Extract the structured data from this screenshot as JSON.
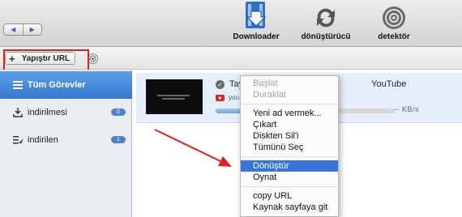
{
  "toolbar": {
    "nav_back_icon": "triangle-left",
    "nav_forward_icon": "triangle-right",
    "tools": [
      {
        "label": "Downloader",
        "icon": "downloader-icon"
      },
      {
        "label": "dönüştürücü",
        "icon": "convert-icon"
      },
      {
        "label": "detektör",
        "icon": "detector-icon"
      }
    ]
  },
  "bar2": {
    "paste_label": "Yapıştır URL",
    "paste_prefix": "+"
  },
  "sidebar": {
    "items": [
      {
        "label": "Tüm Görevler",
        "icon": "list-icon",
        "active": true
      },
      {
        "label": "indirilmesi",
        "icon": "download-tray-icon",
        "count": "0"
      },
      {
        "label": "indirilen",
        "icon": "downloaded-list-icon",
        "count": "1"
      }
    ]
  },
  "task": {
    "title_start": "Tay",
    "title_end": "YouTube",
    "source": "you",
    "speed": "-- KB/s",
    "progress": 0.42
  },
  "context_menu": {
    "items": [
      {
        "label": "Başlat",
        "enabled": false
      },
      {
        "label": "Duraklat",
        "enabled": false
      },
      {
        "label": "Yeni ad vermek...",
        "enabled": true
      },
      {
        "label": "Çıkart",
        "enabled": true
      },
      {
        "label": "Diskten Sil'i",
        "enabled": true
      },
      {
        "label": "Tümünü Seç",
        "enabled": true
      },
      {
        "label": "Dönüştür",
        "enabled": true,
        "selected": true
      },
      {
        "label": "Oynat",
        "enabled": true
      },
      {
        "label": "copy URL",
        "enabled": true
      },
      {
        "label": "Kaynak sayfaya git",
        "enabled": true
      }
    ]
  },
  "colors": {
    "accent": "#3875d7",
    "sidebar_active": "#3f82d6",
    "annotation_red": "#e0201f"
  }
}
